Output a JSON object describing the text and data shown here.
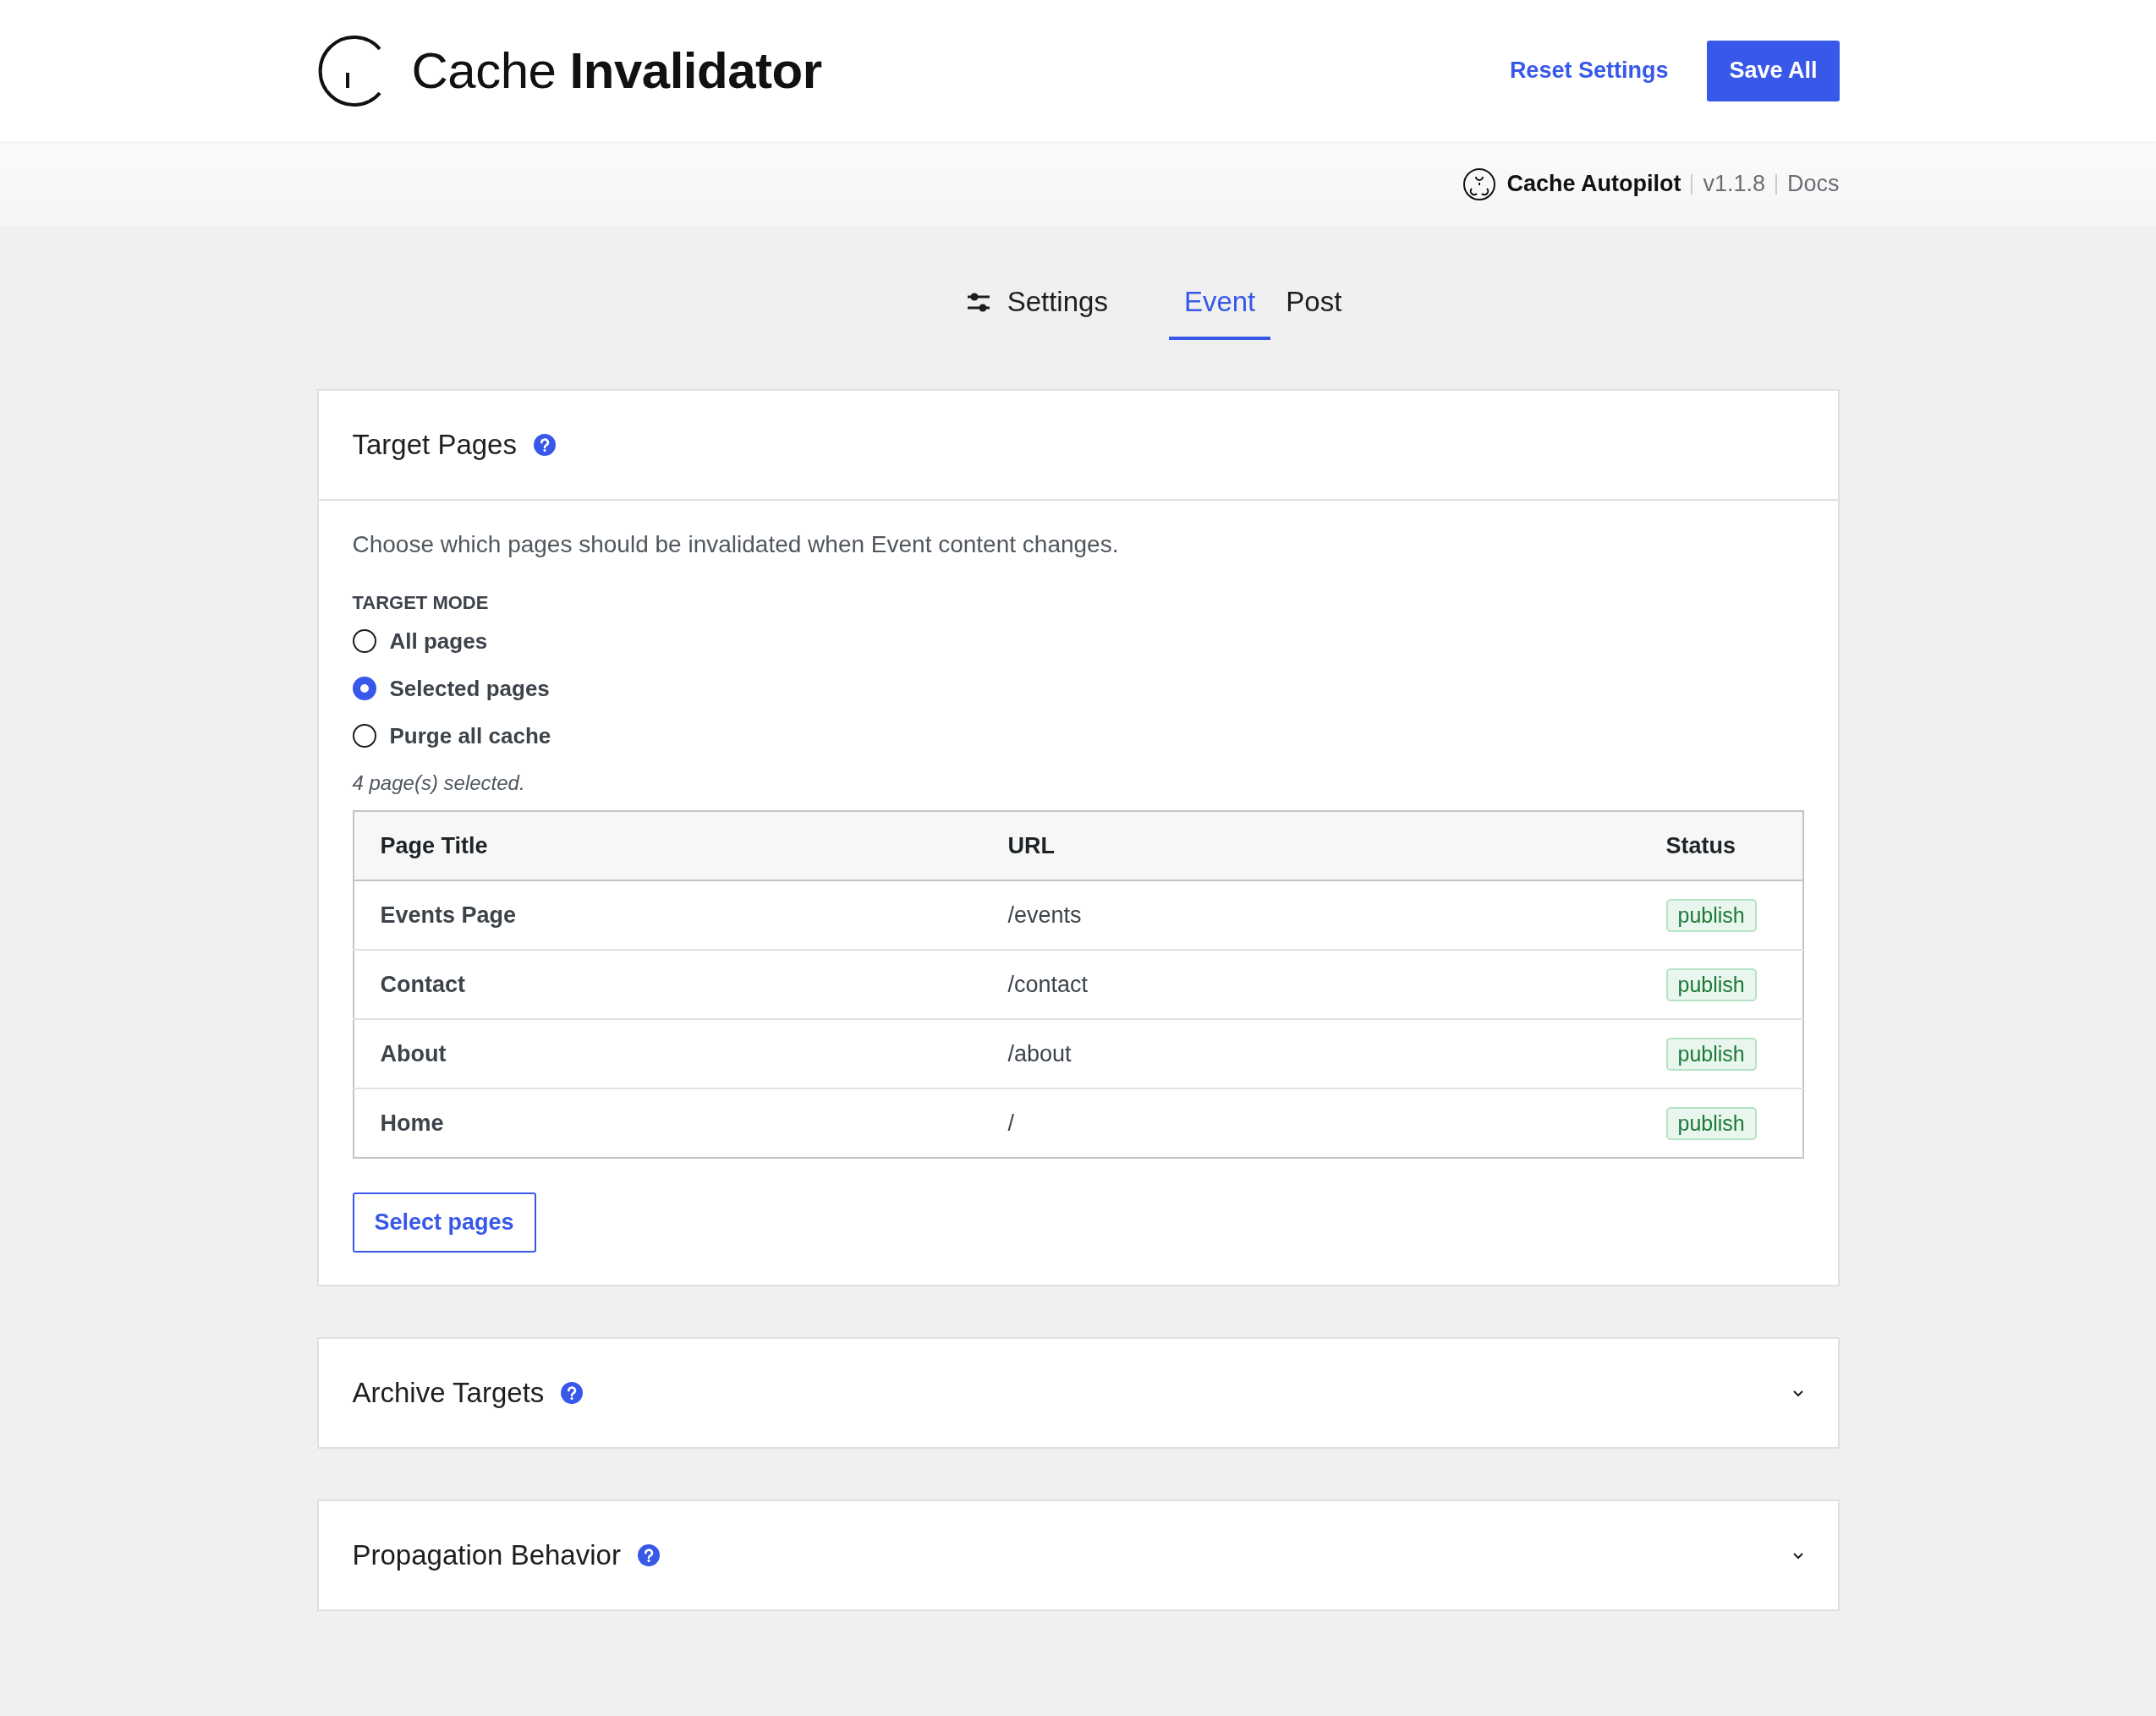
{
  "header": {
    "title": "Cache **Invalidator**",
    "actions": [
      {
        "kind": "link",
        "label": "Reset Settings"
      },
      {
        "kind": "primary",
        "label": "Save All"
      }
    ]
  },
  "sub_bar": {
    "brand": "Cache Autopilot",
    "version": "v1.1.8",
    "docs": "Docs"
  },
  "tabs": [
    {
      "kind": "icon",
      "label": "Settings",
      "selected": false
    },
    {
      "kind": "plain",
      "label": "Event",
      "selected": true
    },
    {
      "kind": "plain",
      "label": "Post",
      "selected": false
    }
  ],
  "panels": [
    {
      "title": "Target Pages",
      "expanded": true,
      "description": "Choose which pages should be invalidated when Event content changes.",
      "target_mode": {
        "label": "TARGET MODE",
        "options": [
          {
            "label": "All pages",
            "selected": false
          },
          {
            "label": "Selected pages",
            "selected": true
          },
          {
            "label": "Purge all cache",
            "selected": false
          }
        ]
      },
      "selection_note": "4 page(s) selected.",
      "table": {
        "columns": [
          "Page Title",
          "URL",
          "Status"
        ],
        "rows": [
          {
            "title": "Events Page",
            "url": "/events",
            "status": "publish"
          },
          {
            "title": "Contact",
            "url": "/contact",
            "status": "publish"
          },
          {
            "title": "About",
            "url": "/about",
            "status": "publish"
          },
          {
            "title": "Home",
            "url": "/",
            "status": "publish"
          }
        ]
      },
      "button": "Select pages"
    },
    {
      "title": "Archive Targets",
      "expanded": false
    },
    {
      "title": "Propagation Behavior",
      "expanded": false
    }
  ]
}
